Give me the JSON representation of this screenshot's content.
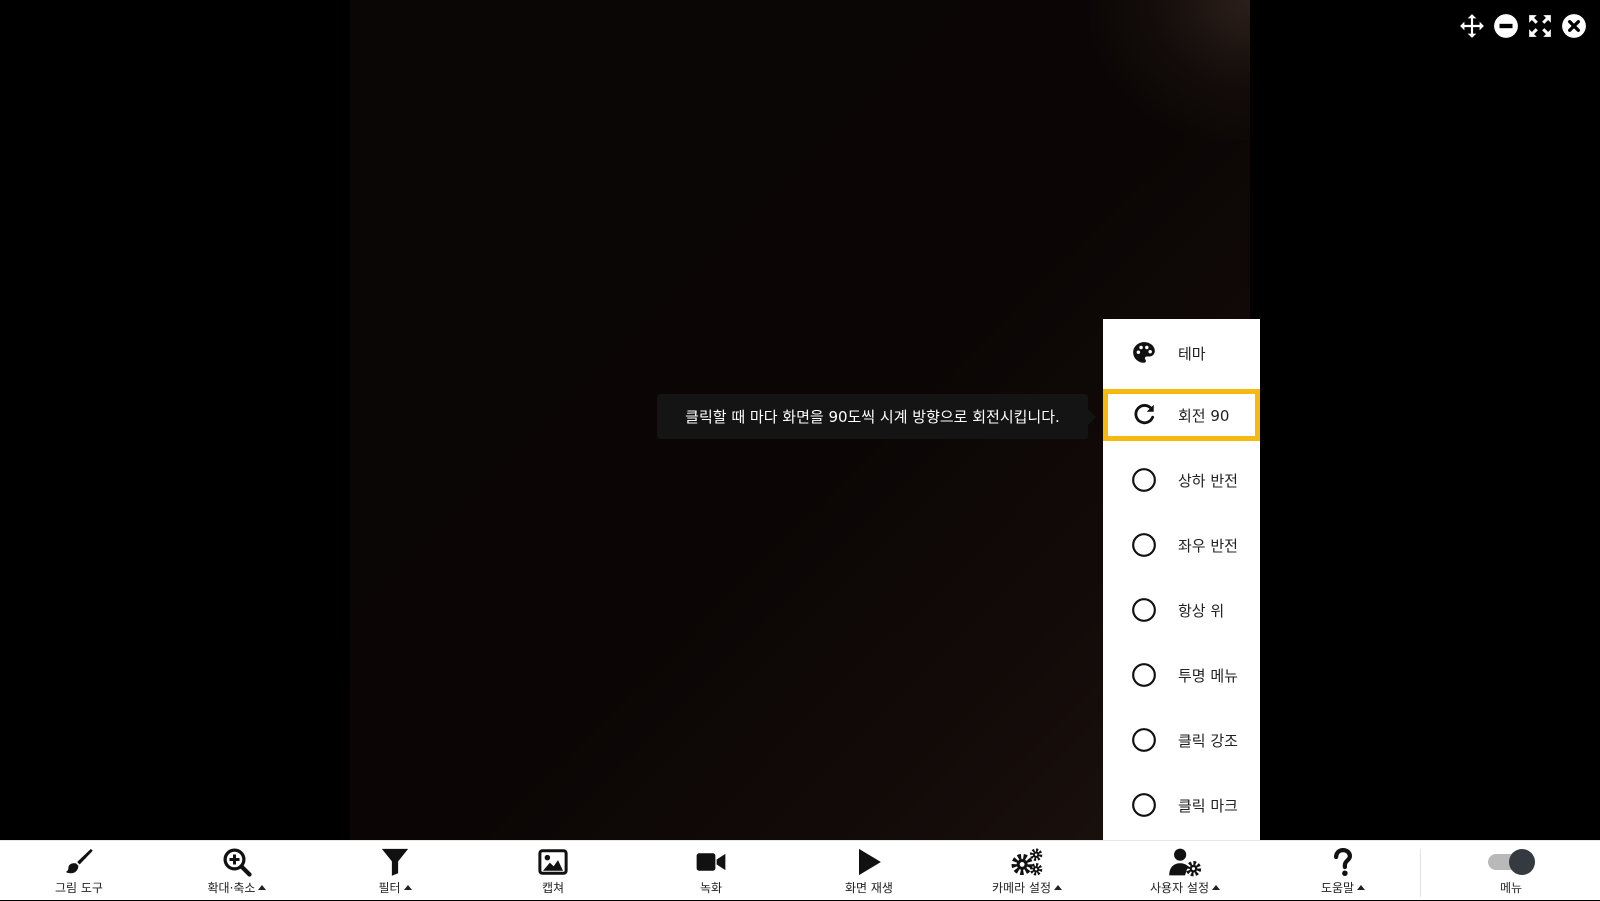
{
  "window_controls": [
    {
      "icon": "move-icon"
    },
    {
      "icon": "minimize-icon"
    },
    {
      "icon": "fullscreen-icon"
    },
    {
      "icon": "close-icon"
    }
  ],
  "tooltip": {
    "text": "클릭할 때 마다 화면을 90도씩 시계 방향으로 회전시킵니다."
  },
  "side_menu": {
    "items": [
      {
        "label": "테마",
        "icon": "palette-icon",
        "active": false
      },
      {
        "label": "회전 90",
        "icon": "rotate-icon",
        "active": true
      },
      {
        "label": "상하 반전",
        "icon": "radio-unchecked-icon",
        "active": false
      },
      {
        "label": "좌우 반전",
        "icon": "radio-unchecked-icon",
        "active": false
      },
      {
        "label": "항상 위",
        "icon": "radio-unchecked-icon",
        "active": false
      },
      {
        "label": "투명 메뉴",
        "icon": "radio-unchecked-icon",
        "active": false
      },
      {
        "label": "클릭 강조",
        "icon": "radio-unchecked-icon",
        "active": false
      },
      {
        "label": "클릭 마크",
        "icon": "radio-unchecked-icon",
        "active": false
      }
    ],
    "highlight_color": "#f5b90f"
  },
  "toolbar": {
    "items": [
      {
        "label": "그림 도구",
        "icon": "brush-icon",
        "has_caret": false
      },
      {
        "label": "확대·축소",
        "icon": "zoom-in-icon",
        "has_caret": true
      },
      {
        "label": "필터",
        "icon": "filter-icon",
        "has_caret": true
      },
      {
        "label": "캡쳐",
        "icon": "image-icon",
        "has_caret": false
      },
      {
        "label": "녹화",
        "icon": "video-camera-icon",
        "has_caret": false
      },
      {
        "label": "화면 재생",
        "icon": "play-icon",
        "has_caret": false
      },
      {
        "label": "카메라 설정",
        "icon": "gears-icon",
        "has_caret": true
      },
      {
        "label": "사용자 설정",
        "icon": "user-gear-icon",
        "has_caret": true
      },
      {
        "label": "도움말",
        "icon": "question-icon",
        "has_caret": true
      }
    ],
    "menu_toggle": {
      "label": "메뉴",
      "icon": "toggle-on-icon",
      "state": "on"
    }
  }
}
